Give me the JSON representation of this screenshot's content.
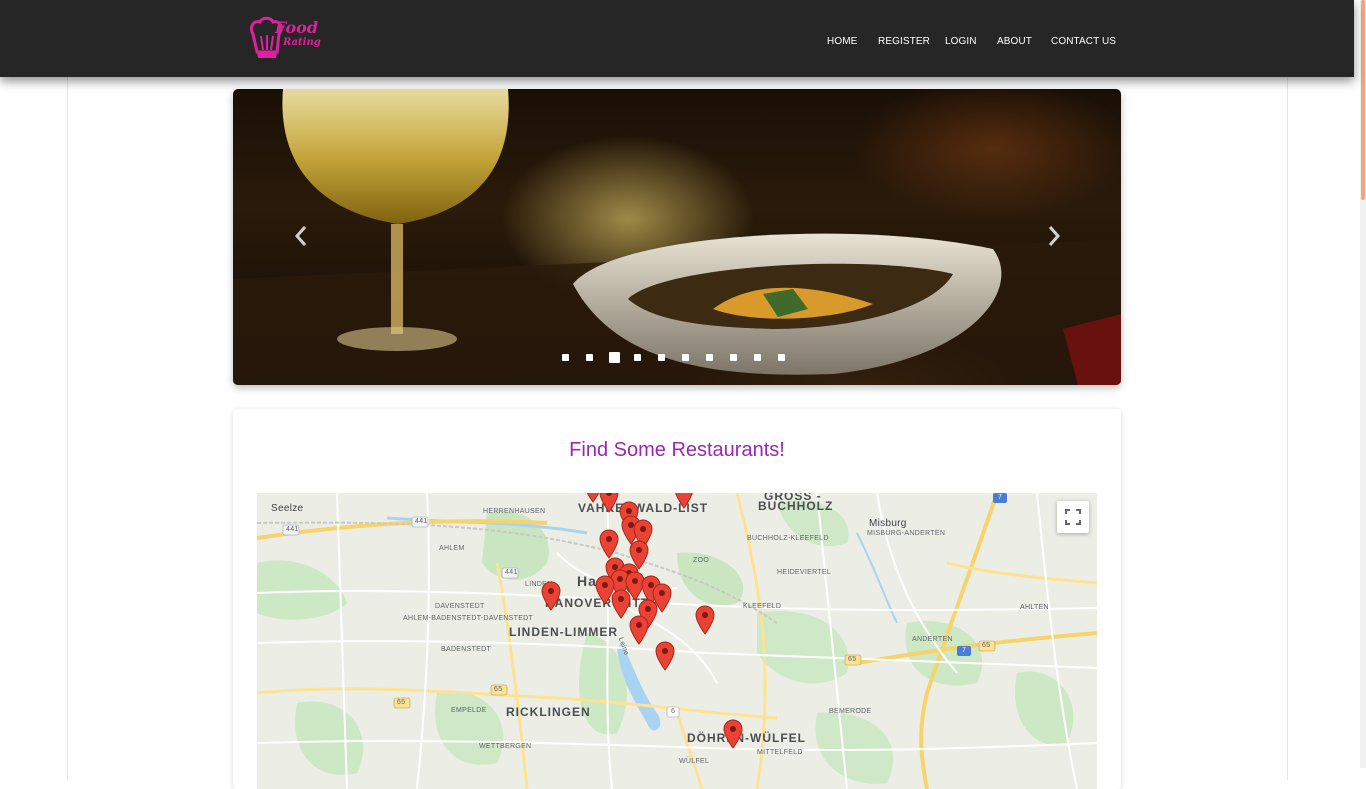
{
  "navbar": {
    "logo_text_line1": "Food",
    "logo_text_line2": "Rating",
    "links": [
      "HOME",
      "REGISTER",
      "LOGIN",
      "ABOUT",
      "CONTACT US"
    ],
    "background": "#262626",
    "logo_color": "#e0219e"
  },
  "carousel": {
    "slide_count": 10,
    "active_slide": 3,
    "prev_icon": "chevron-left-icon",
    "next_icon": "chevron-right-icon"
  },
  "restaurants": {
    "title": "Find Some Restaurants!",
    "title_color": "#9c27b0"
  },
  "map": {
    "fullscreen_icon": "fullscreen-icon",
    "labels": {
      "seelze": "Seelze",
      "herrenhausen": "HERRENHAUSEN",
      "vahrenwald": "VAHRENWALD-LIST",
      "gross_buchholz_1": "GROSS -",
      "gross_buchholz_2": "BUCHHOLZ",
      "misburg": "Misburg",
      "misburg_anderten": "MISBURG-ANDERTEN",
      "buchholz_kleefeld": "BUCHHOLZ-KLEEFELD",
      "ahlem": "AHLEM",
      "zoo": "ZOO",
      "heideviertel": "HEIDEVIERTEL",
      "linden": "LINDEN",
      "han": "Han",
      "hannover_mitte": "HANOVER-MITTE",
      "davenstedt": "DAVENSTEDT",
      "ahlem_badenstedt": "AHLEM-BADENSTEDT-DAVENSTEDT",
      "linden_limmer": "LINDEN-LIMMER",
      "kleefeld": "KLEEFELD",
      "ahlten": "AHLTEN",
      "anderten": "ANDERTEN",
      "badenstedt": "BADENSTEDT",
      "leine": "Leine",
      "empelde": "EMPELDE",
      "ricklingen": "RICKLINGEN",
      "bemerode": "BEMERODE",
      "wettbergen": "WETTBERGEN",
      "dohren_wulfel": "DÖHREN-WÜLFEL",
      "mittelfeld": "MITTELFELD",
      "wulfel": "WÜLFEL"
    },
    "road_shields": [
      "441",
      "441",
      "441",
      "7",
      "7",
      "65",
      "65",
      "65",
      "65",
      "6"
    ],
    "marker_count": 22,
    "marker_color": "#ea4335"
  }
}
